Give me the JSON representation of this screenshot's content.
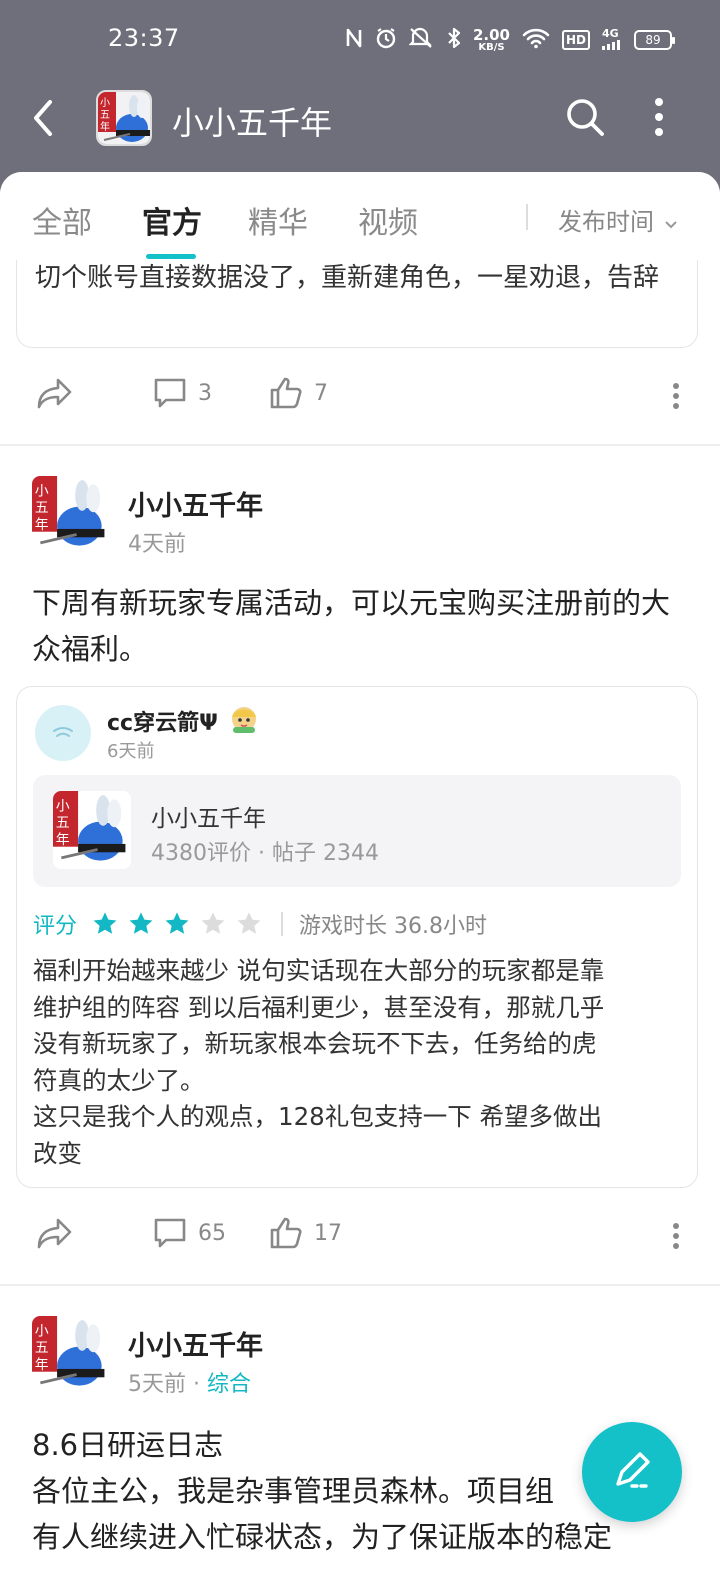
{
  "status_bar": {
    "time": "23:37",
    "net_speed_value": "2.00",
    "net_speed_unit": "KB/S",
    "hd_label": "HD",
    "network": "4G",
    "battery": "89"
  },
  "header": {
    "title": "小小五千年",
    "back_icon": "back-arrow-icon",
    "search_icon": "search-icon",
    "more_icon": "more-vertical-icon"
  },
  "tabs": {
    "items": [
      {
        "label": "全部",
        "active": false
      },
      {
        "label": "官方",
        "active": true
      },
      {
        "label": "精华",
        "active": false
      },
      {
        "label": "视频",
        "active": false
      }
    ],
    "sort_label": "发布时间"
  },
  "clipped_card": {
    "text": "切个账号直接数据没了，重新建角色，一星劝退，告辞"
  },
  "actions_1": {
    "comments": "3",
    "likes": "7"
  },
  "post_1": {
    "author": "小小五千年",
    "time": "4天前",
    "body": "下周有新玩家专属活动，可以元宝购买注册前的大众福利。",
    "review": {
      "user": "cc穿云箭Ψ",
      "time": "6天前",
      "game_name": "小小五千年",
      "game_reviews": "4380评价",
      "game_posts": "帖子 2344",
      "rating_label": "评分",
      "rating": 3,
      "rating_max": 5,
      "playtime": "游戏时长 36.8小时",
      "text_lines": [
        "福利开始越来越少 说句实话现在大部分的玩家都是靠",
        "维护组的阵容 到以后福利更少，甚至没有，那就几乎",
        "没有新玩家了，新玩家根本会玩不下去，任务给的虎",
        "符真的太少了。",
        "这只是我个人的观点，128礼包支持一下 希望多做出",
        "改变"
      ]
    }
  },
  "actions_2": {
    "comments": "65",
    "likes": "17"
  },
  "post_2": {
    "author": "小小五千年",
    "time": "5天前",
    "tag": "综合",
    "title_line": "8.6日研运日志",
    "body_line1": "各位主公，我是杂事管理员森林。项目组",
    "body_line2": "有人继续进入忙碌状态，为了保证版本的稳定"
  },
  "colors": {
    "accent": "#14c1c9",
    "header_bg": "#6e6f7b",
    "star_on": "#14b8c4",
    "star_off": "#dcdcdc"
  }
}
